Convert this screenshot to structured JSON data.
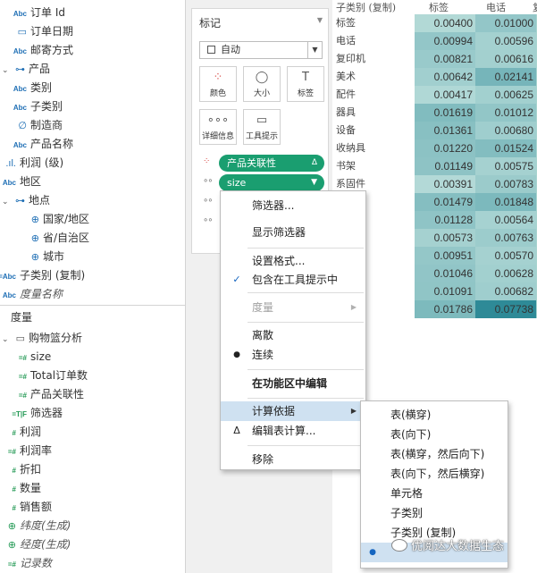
{
  "dims": {
    "fields": [
      {
        "icon": "Abc",
        "label": "订单 Id",
        "kind": "text"
      },
      {
        "icon": "▭",
        "label": "订单日期",
        "kind": "date"
      },
      {
        "icon": "Abc",
        "label": "邮寄方式",
        "kind": "text"
      },
      {
        "icon": "⊶",
        "label": "产品",
        "kind": "hierarchy"
      },
      {
        "icon": "Abc",
        "label": "类别",
        "kind": "text"
      },
      {
        "icon": "Abc",
        "label": "子类别",
        "kind": "text"
      },
      {
        "icon": "∅",
        "label": "制造商",
        "kind": "group"
      },
      {
        "icon": "Abc",
        "label": "产品名称",
        "kind": "text"
      },
      {
        "icon": ".ıl.",
        "label": "利润 (级)",
        "kind": "bin"
      },
      {
        "icon": "Abc",
        "label": "地区",
        "kind": "text"
      },
      {
        "icon": "⊶",
        "label": "地点",
        "kind": "hierarchy"
      },
      {
        "icon": "⊕",
        "label": "国家/地区",
        "kind": "geo"
      },
      {
        "icon": "⊕",
        "label": "省/自治区",
        "kind": "geo"
      },
      {
        "icon": "⊕",
        "label": "城市",
        "kind": "geo"
      },
      {
        "icon": "=Abc",
        "label": "子类别 (复制)",
        "kind": "calc-text"
      },
      {
        "icon": "Abc",
        "label": "度量名称",
        "kind": "text"
      }
    ]
  },
  "measures": {
    "header": "度量",
    "fields": [
      {
        "icon": "▭",
        "label": "购物篮分析",
        "kind": "folder"
      },
      {
        "icon": "=#",
        "label": "size",
        "kind": "calc"
      },
      {
        "icon": "=#",
        "label": "Total订单数",
        "kind": "calc"
      },
      {
        "icon": "=#",
        "label": "产品关联性",
        "kind": "calc"
      },
      {
        "icon": "=T|F",
        "label": "筛选器",
        "kind": "calc"
      },
      {
        "icon": "#",
        "label": "利润",
        "kind": "num"
      },
      {
        "icon": "=#",
        "label": "利润率",
        "kind": "calc"
      },
      {
        "icon": "#",
        "label": "折扣",
        "kind": "num"
      },
      {
        "icon": "#",
        "label": "数量",
        "kind": "num"
      },
      {
        "icon": "#",
        "label": "销售额",
        "kind": "num"
      },
      {
        "icon": "⊕",
        "label": "纬度(生成)",
        "kind": "geo-gen"
      },
      {
        "icon": "⊕",
        "label": "经度(生成)",
        "kind": "geo-gen"
      },
      {
        "icon": "=#",
        "label": "记录数",
        "kind": "calc-gen"
      }
    ]
  },
  "marks": {
    "title": "标记",
    "mark_type": "自动",
    "buttons": [
      {
        "icon": "⁘",
        "label": "颜色"
      },
      {
        "icon": "◯",
        "label": "大小"
      },
      {
        "icon": "T",
        "label": "标签"
      },
      {
        "icon": "∘∘∘",
        "label": "详细信息"
      },
      {
        "icon": "▭",
        "label": "工具提示"
      }
    ],
    "pills": [
      {
        "label": "产品关联性",
        "right": "Δ"
      },
      {
        "label": "size",
        "right": "▼"
      }
    ]
  },
  "table": {
    "headers": [
      "子类别 (复制)",
      "标签",
      "电话",
      "复"
    ],
    "rows": [
      {
        "label": "标签",
        "v1": "0.00400",
        "v2": "0.01000"
      },
      {
        "label": "电话",
        "v1": "0.00994",
        "v2": "0.00596"
      },
      {
        "label": "复印机",
        "v1": "0.00821",
        "v2": "0.00616"
      },
      {
        "label": "美术",
        "v1": "0.00642",
        "v2": "0.02141"
      },
      {
        "label": "配件",
        "v1": "0.00417",
        "v2": "0.00625"
      },
      {
        "label": "器具",
        "v1": "0.01619",
        "v2": "0.01012"
      },
      {
        "label": "设备",
        "v1": "0.01361",
        "v2": "0.00680"
      },
      {
        "label": "收纳具",
        "v1": "0.01220",
        "v2": "0.01524"
      },
      {
        "label": "书架",
        "v1": "0.01149",
        "v2": "0.00575"
      },
      {
        "label": "系固件",
        "v1": "0.00391",
        "v2": "0.00783"
      },
      {
        "label": "",
        "v1": "0.01479",
        "v2": "0.01848"
      },
      {
        "label": "",
        "v1": "0.01128",
        "v2": "0.00564"
      },
      {
        "label": "",
        "v1": "0.00573",
        "v2": "0.00763"
      },
      {
        "label": "",
        "v1": "0.00951",
        "v2": "0.00570"
      },
      {
        "label": "",
        "v1": "0.01046",
        "v2": "0.00628"
      },
      {
        "label": "机",
        "v1": "0.01091",
        "v2": "0.00682"
      },
      {
        "label": "",
        "v1": "0.01786",
        "v2": "0.07738"
      }
    ]
  },
  "context_menu": {
    "items": [
      {
        "label": "筛选器...",
        "mark": "",
        "arrow": false,
        "disabled": false,
        "bold": false,
        "hl": false
      },
      {
        "label": "显示筛选器",
        "mark": "",
        "arrow": false,
        "disabled": false,
        "bold": false,
        "hl": false
      },
      {
        "label": "设置格式...",
        "mark": "",
        "arrow": false,
        "disabled": false,
        "bold": false,
        "hl": false
      },
      {
        "label": "包含在工具提示中",
        "mark": "✓",
        "arrow": false,
        "disabled": false,
        "bold": false,
        "hl": false
      },
      {
        "label": "度量",
        "mark": "",
        "arrow": true,
        "disabled": true,
        "bold": false,
        "hl": false
      },
      {
        "label": "离散",
        "mark": "",
        "arrow": false,
        "disabled": false,
        "bold": false,
        "hl": false
      },
      {
        "label": "连续",
        "mark": "●",
        "arrow": false,
        "disabled": false,
        "bold": false,
        "hl": false
      },
      {
        "label": "在功能区中编辑",
        "mark": "",
        "arrow": false,
        "disabled": false,
        "bold": true,
        "hl": false
      },
      {
        "label": "计算依据",
        "mark": "",
        "arrow": true,
        "disabled": false,
        "bold": false,
        "hl": true
      },
      {
        "label": "编辑表计算...",
        "mark": "Δ",
        "arrow": false,
        "disabled": false,
        "bold": false,
        "hl": false
      },
      {
        "label": "移除",
        "mark": "",
        "arrow": false,
        "disabled": false,
        "bold": false,
        "hl": false
      }
    ]
  },
  "sub_menu": {
    "items": [
      {
        "label": "表(横穿)",
        "mark": ""
      },
      {
        "label": "表(向下)",
        "mark": ""
      },
      {
        "label": "表(横穿，然后向下)",
        "mark": ""
      },
      {
        "label": "表(向下，然后横穿)",
        "mark": ""
      },
      {
        "label": "单元格",
        "mark": ""
      },
      {
        "label": "子类别",
        "mark": ""
      },
      {
        "label": "子类别 (复制)",
        "mark": ""
      },
      {
        "label": "",
        "mark": "●"
      }
    ]
  },
  "watermark": "优阅达大数据生态",
  "colors": {
    "pill": "#1a9e70",
    "menu_highlight": "#cfe1f1",
    "dim_icon": "#1f6fb5",
    "measure_icon": "#229954"
  }
}
